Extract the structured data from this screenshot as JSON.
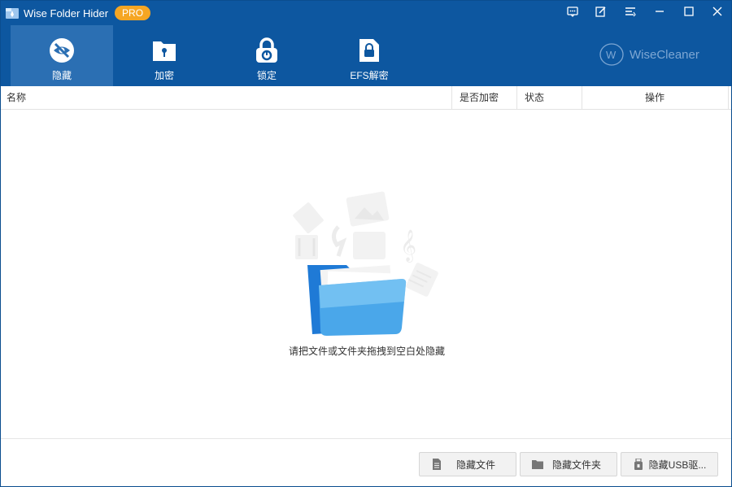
{
  "app": {
    "title": "Wise Folder Hider",
    "badge": "PRO"
  },
  "window_controls": [
    "feedback-icon",
    "edit-icon",
    "menu-icon",
    "minimize-icon",
    "maximize-icon",
    "close-icon"
  ],
  "tabs": [
    {
      "label": "隐藏",
      "icon": "eye-hidden-icon",
      "active": true
    },
    {
      "label": "加密",
      "icon": "folder-lock-icon",
      "active": false
    },
    {
      "label": "锁定",
      "icon": "padlock-icon",
      "active": false
    },
    {
      "label": "EFS解密",
      "icon": "file-lock-icon",
      "active": false
    }
  ],
  "brand": {
    "logo_letter": "W",
    "name": "WiseCleaner"
  },
  "table": {
    "columns": [
      "名称",
      "是否加密",
      "状态",
      "操作"
    ],
    "rows": []
  },
  "empty_state": {
    "message": "请把文件或文件夹拖拽到空白处隐藏"
  },
  "footer": {
    "buttons": [
      {
        "label": "隐藏文件",
        "icon": "file-icon"
      },
      {
        "label": "隐藏文件夹",
        "icon": "folder-icon"
      },
      {
        "label": "隐藏USB驱...",
        "icon": "usb-lock-icon"
      }
    ]
  },
  "colors": {
    "header_bg": "#0d57a0",
    "active_tab": "#2b6fb3",
    "badge": "#f5a623",
    "brand_text": "#7ea7d3"
  }
}
